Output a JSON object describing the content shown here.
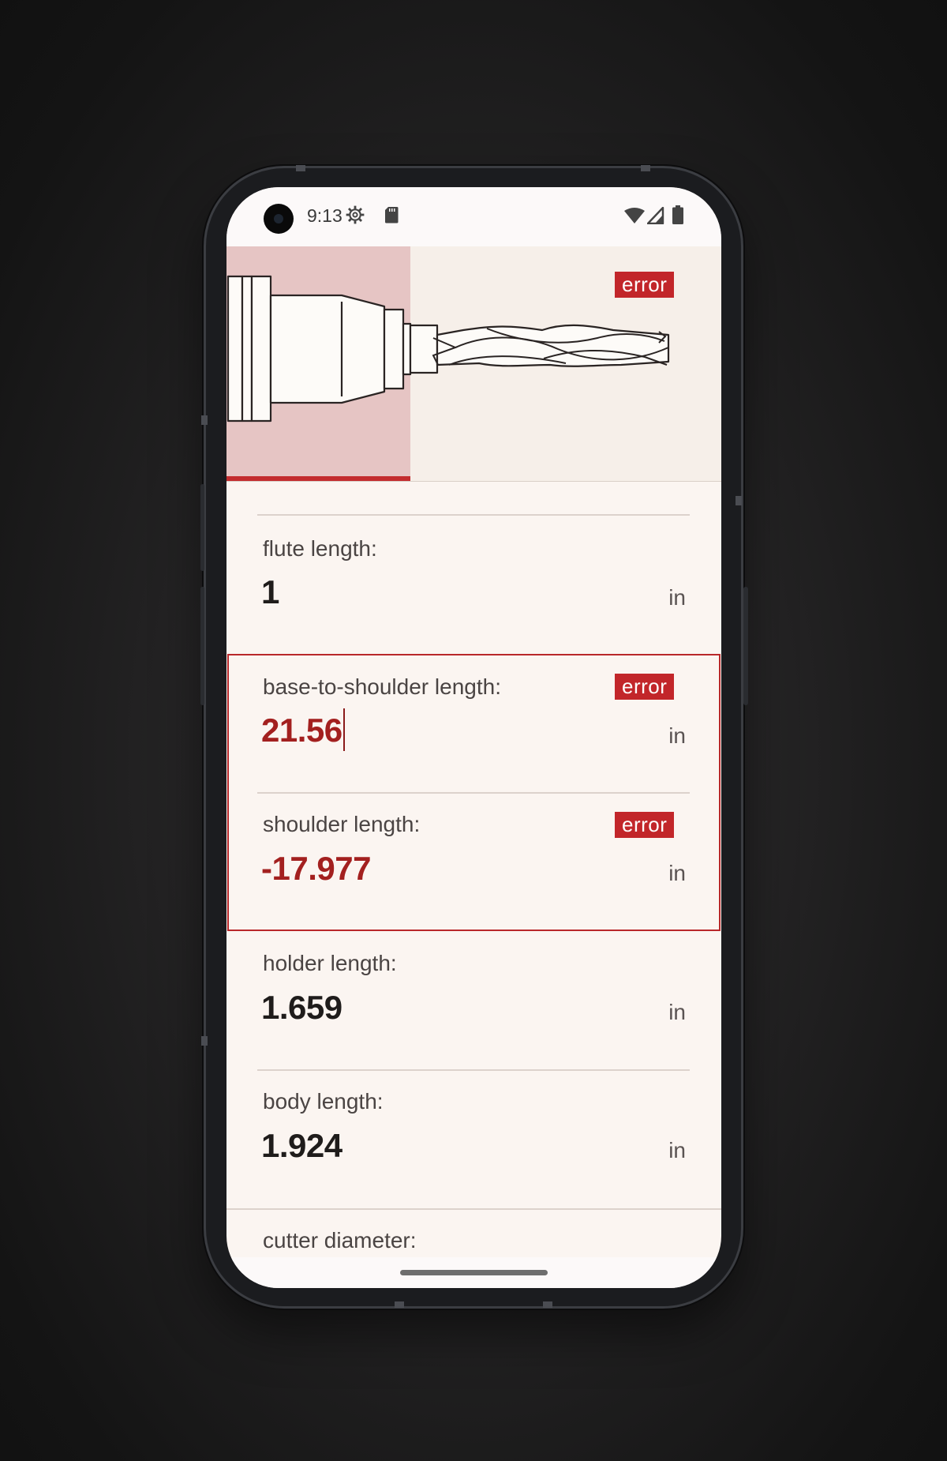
{
  "status_bar": {
    "time": "9:13",
    "left_icons": [
      "gear-icon",
      "sd-card-icon"
    ],
    "right_icons": [
      "wifi-icon",
      "signal-icon",
      "battery-icon"
    ]
  },
  "hero": {
    "badge": "error",
    "illustration": "tool-holder-with-end-mill"
  },
  "fields": [
    {
      "label": "flute length:",
      "value": "1",
      "unit": "in",
      "error": false
    },
    {
      "label": "base-to-shoulder length:",
      "value": "21.56",
      "unit": "in",
      "error": true,
      "badge": "error",
      "focused": true
    },
    {
      "label": "shoulder length:",
      "value": "-17.977",
      "unit": "in",
      "error": true,
      "badge": "error"
    },
    {
      "label": "holder length:",
      "value": "1.659",
      "unit": "in",
      "error": false
    },
    {
      "label": "body length:",
      "value": "1.924",
      "unit": "in",
      "error": false
    },
    {
      "label": "cutter diameter:",
      "value": "",
      "unit": "",
      "error": false
    }
  ],
  "colors": {
    "background": "#fbf5f1",
    "error": "#c2262a",
    "error_text": "#a3201f",
    "highlight": "#e6c5c4"
  }
}
